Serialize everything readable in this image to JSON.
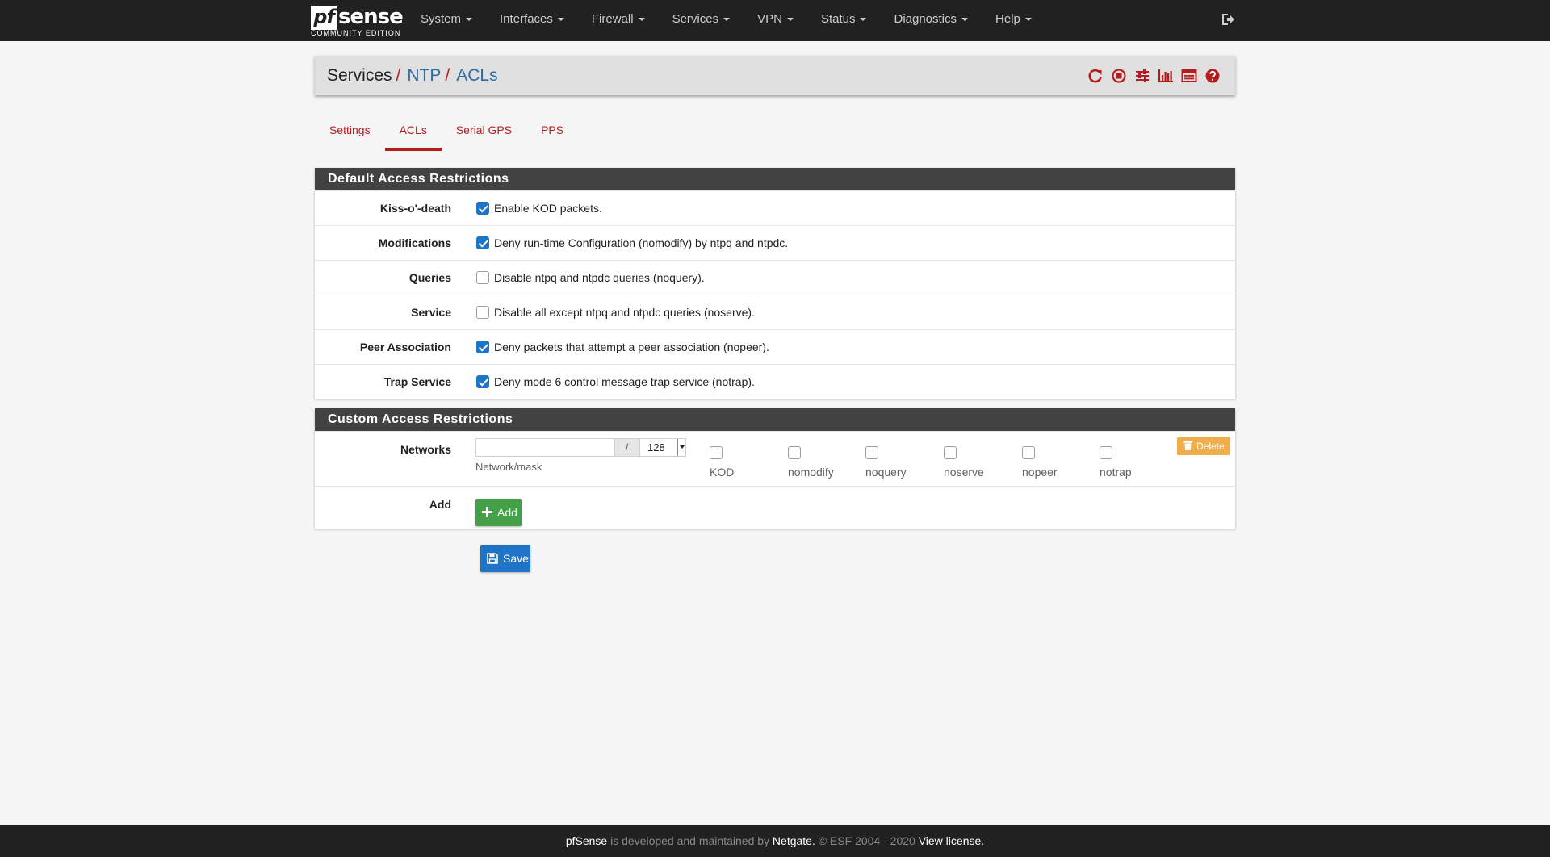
{
  "brand": {
    "pf": "pf",
    "sense": "sense",
    "edition": "COMMUNITY EDITION"
  },
  "nav": {
    "items": [
      "System",
      "Interfaces",
      "Firewall",
      "Services",
      "VPN",
      "Status",
      "Diagnostics",
      "Help"
    ],
    "logout_icon": "sign-out-icon"
  },
  "breadcrumb": {
    "section": "Services",
    "sep": "/",
    "page": "NTP",
    "subpage": "ACLs"
  },
  "header_icons": [
    "restart-service-icon",
    "stop-service-icon",
    "settings-sliders-icon",
    "status-graph-icon",
    "log-list-icon",
    "help-icon"
  ],
  "tabs": [
    {
      "label": "Settings",
      "active": false
    },
    {
      "label": "ACLs",
      "active": true
    },
    {
      "label": "Serial GPS",
      "active": false
    },
    {
      "label": "PPS",
      "active": false
    }
  ],
  "default_panel": {
    "title": "Default Access Restrictions",
    "rows": [
      {
        "label": "Kiss-o'-death",
        "text": "Enable KOD packets.",
        "checked": true
      },
      {
        "label": "Modifications",
        "text": "Deny run-time Configuration (nomodify) by ntpq and ntpdc.",
        "checked": true
      },
      {
        "label": "Queries",
        "text": "Disable ntpq and ntpdc queries (noquery).",
        "checked": false
      },
      {
        "label": "Service",
        "text": "Disable all except ntpq and ntpdc queries (noserve).",
        "checked": false
      },
      {
        "label": "Peer Association",
        "text": "Deny packets that attempt a peer association (nopeer).",
        "checked": true
      },
      {
        "label": "Trap Service",
        "text": "Deny mode 6 control message trap service (notrap).",
        "checked": true
      }
    ]
  },
  "custom_panel": {
    "title": "Custom Access Restrictions",
    "networks_label": "Networks",
    "network_value": "",
    "slash": "/",
    "mask_value": "128",
    "network_hint": "Network/mask",
    "flags": [
      {
        "label": "KOD",
        "checked": false
      },
      {
        "label": "nomodify",
        "checked": false
      },
      {
        "label": "noquery",
        "checked": false
      },
      {
        "label": "noserve",
        "checked": false
      },
      {
        "label": "nopeer",
        "checked": false
      },
      {
        "label": "notrap",
        "checked": false
      }
    ],
    "delete_label": "Delete",
    "add_row_label": "Add",
    "add_button": "Add"
  },
  "save_button": "Save",
  "footer": {
    "brand": "pfSense",
    "middle": " is developed and maintained by ",
    "company": "Netgate.",
    "copyright": " © ESF 2004 - 2020 ",
    "license": "View license."
  },
  "colors": {
    "accent": "#b71c1c",
    "link": "#2b6ca3",
    "primary": "#1e74c7",
    "success": "#43a047",
    "warning": "#f0ad4e",
    "dark": "#212121"
  }
}
